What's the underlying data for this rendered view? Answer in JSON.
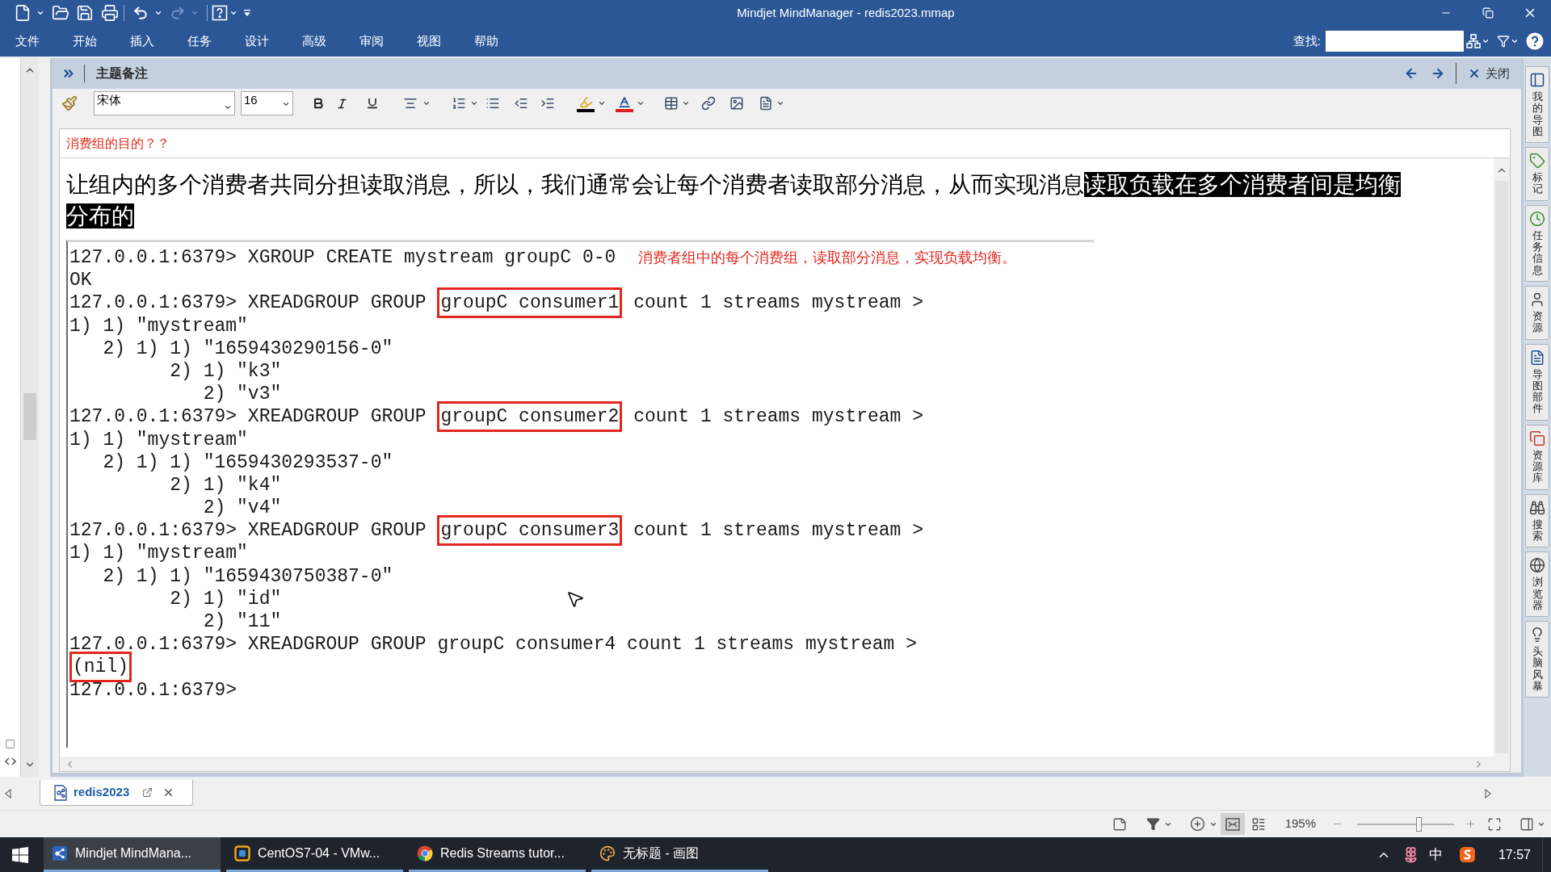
{
  "window": {
    "title": "Mindjet MindManager - redis2023.mmap"
  },
  "quick_access": {
    "redo_disabled": true
  },
  "menu_bar": [
    "文件",
    "开始",
    "插入",
    "任务",
    "设计",
    "高级",
    "审阅",
    "视图",
    "帮助"
  ],
  "search": {
    "label": "查找:"
  },
  "notes_panel": {
    "title": "主题备注",
    "close_label": "关闭",
    "font": "宋体",
    "font_size": "16"
  },
  "note": {
    "title": "消费组的目的？？",
    "body": [
      {
        "text": "让组内的多个消费者共同分担读取消息，所以，我们通常会让每个消费者读取部分消息，从而实现消息",
        "highlighted": false
      },
      {
        "text": "读取负载在多个消费者间是均衡分布的",
        "highlighted": true
      }
    ],
    "terminal": {
      "lines": [
        {
          "segments": [
            {
              "text": "127.0.0.1:6379> XGROUP CREATE mystream groupC 0-0",
              "boxed": false
            }
          ],
          "note": "消费者组中的每个消费组，读取部分消息，实现负载均衡。"
        },
        {
          "segments": [
            {
              "text": "OK",
              "boxed": false
            }
          ]
        },
        {
          "segments": [
            {
              "text": "127.0.0.1:6379> XREADGROUP GROUP",
              "boxed": false
            },
            {
              "text": "groupC consumer1",
              "boxed": true
            },
            {
              "text": "count 1 streams mystream >",
              "boxed": false
            }
          ]
        },
        {
          "segments": [
            {
              "text": "1) 1) \"mystream\"",
              "boxed": false
            }
          ]
        },
        {
          "segments": [
            {
              "text": "   2) 1) 1) \"1659430290156-0\"",
              "boxed": false
            }
          ]
        },
        {
          "segments": [
            {
              "text": "         2) 1) \"k3\"",
              "boxed": false
            }
          ]
        },
        {
          "segments": [
            {
              "text": "            2) \"v3\"",
              "boxed": false
            }
          ]
        },
        {
          "segments": [
            {
              "text": "127.0.0.1:6379> XREADGROUP GROUP",
              "boxed": false
            },
            {
              "text": "groupC consumer2",
              "boxed": true
            },
            {
              "text": "count 1 streams mystream >",
              "boxed": false
            }
          ]
        },
        {
          "segments": [
            {
              "text": "1) 1) \"mystream\"",
              "boxed": false
            }
          ]
        },
        {
          "segments": [
            {
              "text": "   2) 1) 1) \"1659430293537-0\"",
              "boxed": false
            }
          ]
        },
        {
          "segments": [
            {
              "text": "         2) 1) \"k4\"",
              "boxed": false
            }
          ]
        },
        {
          "segments": [
            {
              "text": "            2) \"v4\"",
              "boxed": false
            }
          ]
        },
        {
          "segments": [
            {
              "text": "127.0.0.1:6379> XREADGROUP GROUP",
              "boxed": false
            },
            {
              "text": "groupC consumer3",
              "boxed": true
            },
            {
              "text": "count 1 streams mystream >",
              "boxed": false
            }
          ]
        },
        {
          "segments": [
            {
              "text": "1) 1) \"mystream\"",
              "boxed": false
            }
          ]
        },
        {
          "segments": [
            {
              "text": "   2) 1) 1) \"1659430750387-0\"",
              "boxed": false
            }
          ]
        },
        {
          "segments": [
            {
              "text": "         2) 1) \"id\"",
              "boxed": false
            }
          ]
        },
        {
          "segments": [
            {
              "text": "            2) \"11\"",
              "boxed": false
            }
          ]
        },
        {
          "segments": [
            {
              "text": "127.0.0.1:6379> XREADGROUP GROUP groupC consumer4 count 1 streams mystream >",
              "boxed": false
            }
          ]
        },
        {
          "segments": [
            {
              "text": "(nil)",
              "boxed": true
            }
          ]
        },
        {
          "segments": [
            {
              "text": "127.0.0.1:6379>",
              "boxed": false
            }
          ]
        }
      ]
    }
  },
  "sidebar_tabs": [
    "我的导图",
    "标记",
    "任务信息",
    "资源",
    "导图部件",
    "资源库",
    "搜索",
    "浏览器",
    "头脑风暴"
  ],
  "document_tabs": [
    {
      "label": "redis2023",
      "selected": true
    }
  ],
  "status_bar": {
    "views": [
      {
        "selected": true
      },
      {
        "selected": false
      }
    ],
    "zoom": "195%",
    "zoom_slider": {
      "level": 0.63
    }
  },
  "taskbar": {
    "items": [
      {
        "label": "Mindjet MindMana...",
        "selected": true
      },
      {
        "label": "CentOS7-04 - VMw...",
        "selected": false
      },
      {
        "label": "Redis Streams tutor...",
        "selected": false
      },
      {
        "label": "无标题 - 画图",
        "selected": false
      }
    ],
    "ime": "中",
    "time": "17:57"
  }
}
